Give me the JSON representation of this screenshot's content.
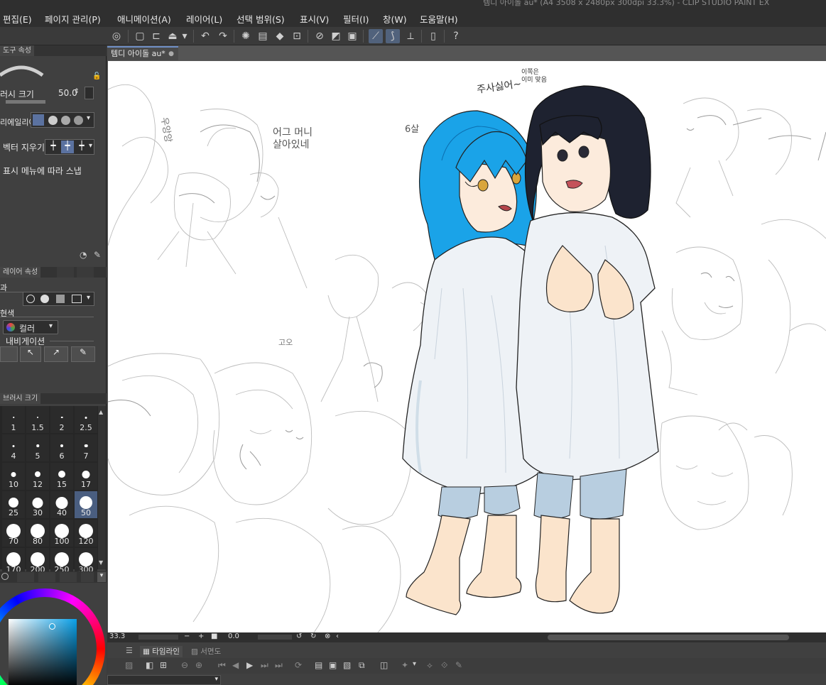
{
  "app": {
    "title": "템디 아이돌 au* (A4 3508 x 2480px 300dpi 33.3%) - CLIP STUDIO PAINT EX"
  },
  "menu": {
    "items": [
      "편집(E)",
      "페이지 관리(P)",
      "애니메이션(A)",
      "레이어(L)",
      "선택 범위(S)",
      "표시(V)",
      "필터(I)",
      "창(W)",
      "도움말(H)"
    ]
  },
  "tool_property": {
    "tab_label": "도구 속성",
    "brush_size_label": "러시 크기",
    "brush_size_value": "50.0",
    "apply_label": "리에일리어",
    "vector_eraser_label": "벡터 지우기",
    "snap_label": "표시 메뉴에 따라 스냅"
  },
  "layer_property": {
    "tab_label": "레이어 속성",
    "effect_label": "과",
    "color_label": "현색",
    "color_value": "컬러",
    "navigation_label": "내비게이션"
  },
  "brush_size_panel": {
    "tab_label": "브러시 크기",
    "sizes": [
      "1",
      "1.5",
      "2",
      "2.5",
      "4",
      "5",
      "6",
      "7",
      "10",
      "12",
      "15",
      "17",
      "25",
      "30",
      "40",
      "50",
      "70",
      "80",
      "100",
      "120",
      "170",
      "200",
      "250",
      "300"
    ],
    "selected": "50"
  },
  "document": {
    "tab_label": "템디 아이돌 au*"
  },
  "canvas_text": {
    "note1": "주사싫어~",
    "note2": "이쪽은\n이미 맞음",
    "note3": "어그 머니\n살아있네",
    "note4": "6살",
    "note5": "우앙앙",
    "note6": "고오"
  },
  "status": {
    "zoom": "33.3",
    "rotation": "0.0"
  },
  "timeline": {
    "tab1": "타임라인",
    "tab2": "서면도"
  },
  "colors": {
    "accent": "#51627c",
    "hair_blue": "#1aa3e8",
    "hair_dark": "#1e2230",
    "gown": "#eef2f6"
  }
}
